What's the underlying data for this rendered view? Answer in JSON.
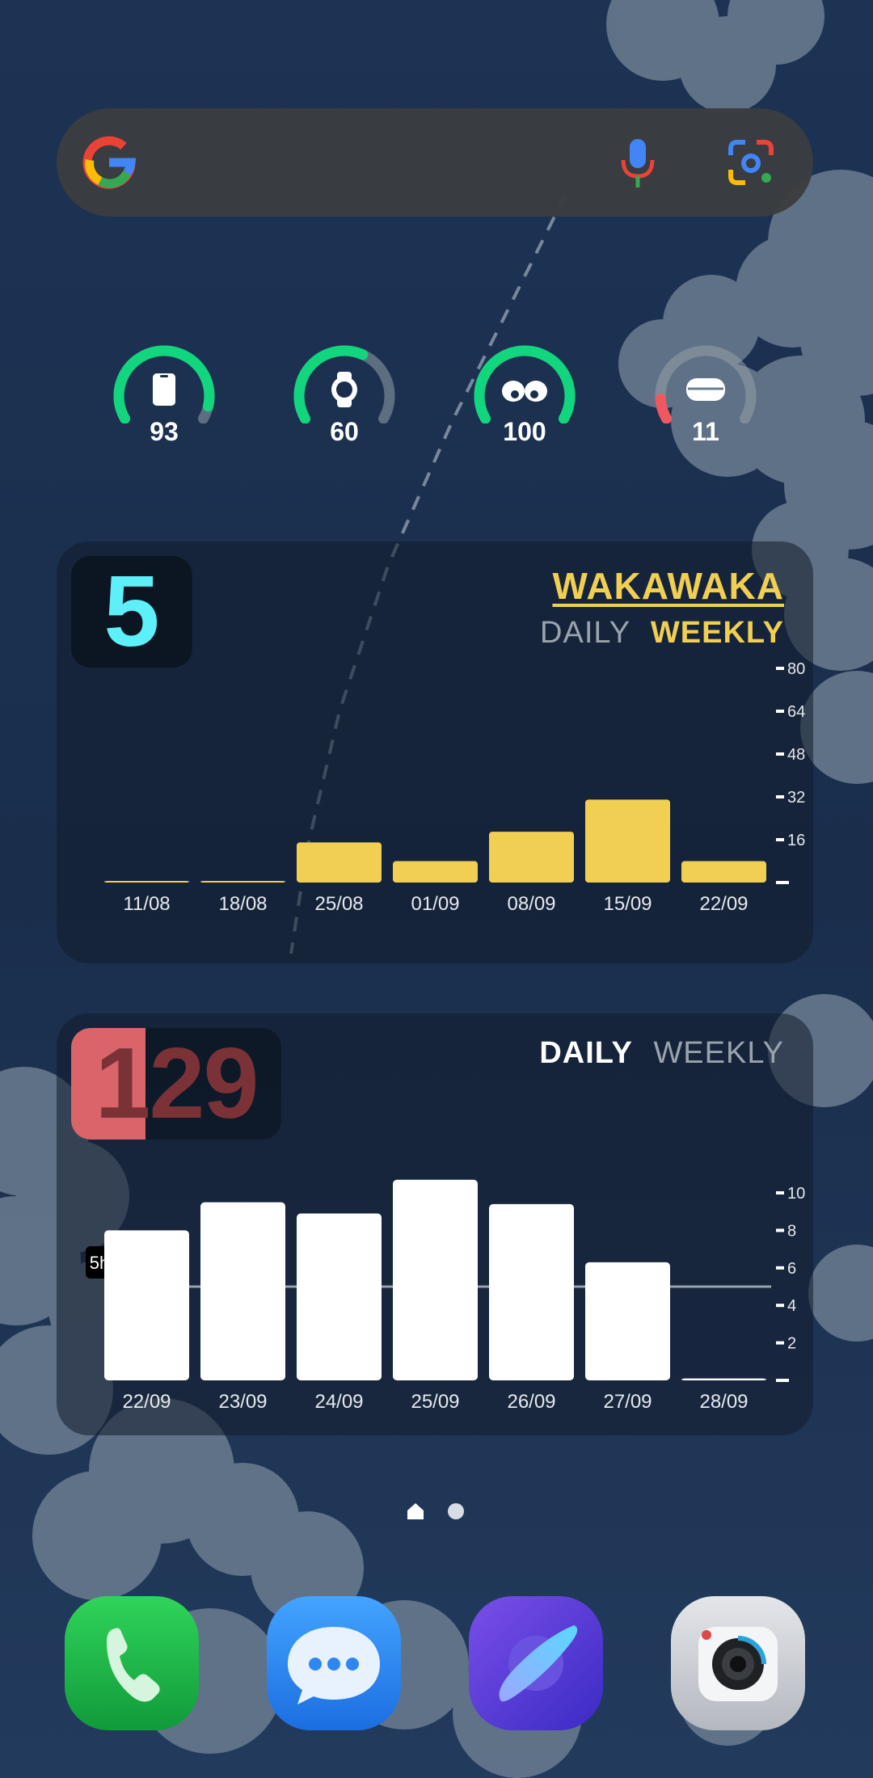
{
  "search_bar": {
    "logo": "google-g-icon",
    "mic_icon": "microphone-icon",
    "lens_icon": "google-lens-icon"
  },
  "battery": [
    {
      "device": "phone-icon",
      "level": 93,
      "label": "93"
    },
    {
      "device": "watch-icon",
      "level": 60,
      "label": "60"
    },
    {
      "device": "earbuds-icon",
      "level": 100,
      "label": "100"
    },
    {
      "device": "earbuds-case-icon",
      "level": 11,
      "label": "11"
    }
  ],
  "colors": {
    "battery_good": "#12d67d",
    "battery_low": "#f0585e",
    "wakatime_accent": "#f1cf52",
    "counter_cyan": "#5ef0f8",
    "screen_red": "#d9646a"
  },
  "wakatime": {
    "counter": "5",
    "title": "WAKAWAKA",
    "tab_daily": "DAILY",
    "tab_weekly": "WEEKLY",
    "active_tab": "WEEKLY"
  },
  "screen_time": {
    "counter": "129",
    "tab_daily": "DAILY",
    "tab_weekly": "WEEKLY",
    "active_tab": "DAILY",
    "reference_label": "5h"
  },
  "chart_data": [
    {
      "type": "bar",
      "categories": [
        "11/08",
        "18/08",
        "25/08",
        "01/09",
        "08/09",
        "15/09",
        "22/09"
      ],
      "values": [
        0.5,
        0,
        15,
        8,
        19,
        31,
        8
      ],
      "ylim": [
        0,
        80
      ],
      "yticks": [
        "16",
        "32",
        "48",
        "64",
        "80"
      ],
      "color": "#f1cf52",
      "grid": false
    },
    {
      "type": "bar",
      "categories": [
        "22/09",
        "23/09",
        "24/09",
        "25/09",
        "26/09",
        "27/09",
        "28/09"
      ],
      "values": [
        8,
        9.5,
        8.9,
        10.7,
        9.4,
        6.3,
        0.1
      ],
      "ylim": [
        0,
        10
      ],
      "yticks": [
        "2",
        "4",
        "6",
        "8",
        "10"
      ],
      "reference_line": 5,
      "color": "#ffffff",
      "grid": false
    }
  ],
  "dock": [
    {
      "name": "phone-app-icon",
      "color": "#1fbf4a"
    },
    {
      "name": "messages-app-icon",
      "color": "#2f86f0"
    },
    {
      "name": "internet-app-icon",
      "color": "#5a3fd6"
    },
    {
      "name": "camera-app-icon",
      "color": "#c9ccd2"
    }
  ]
}
